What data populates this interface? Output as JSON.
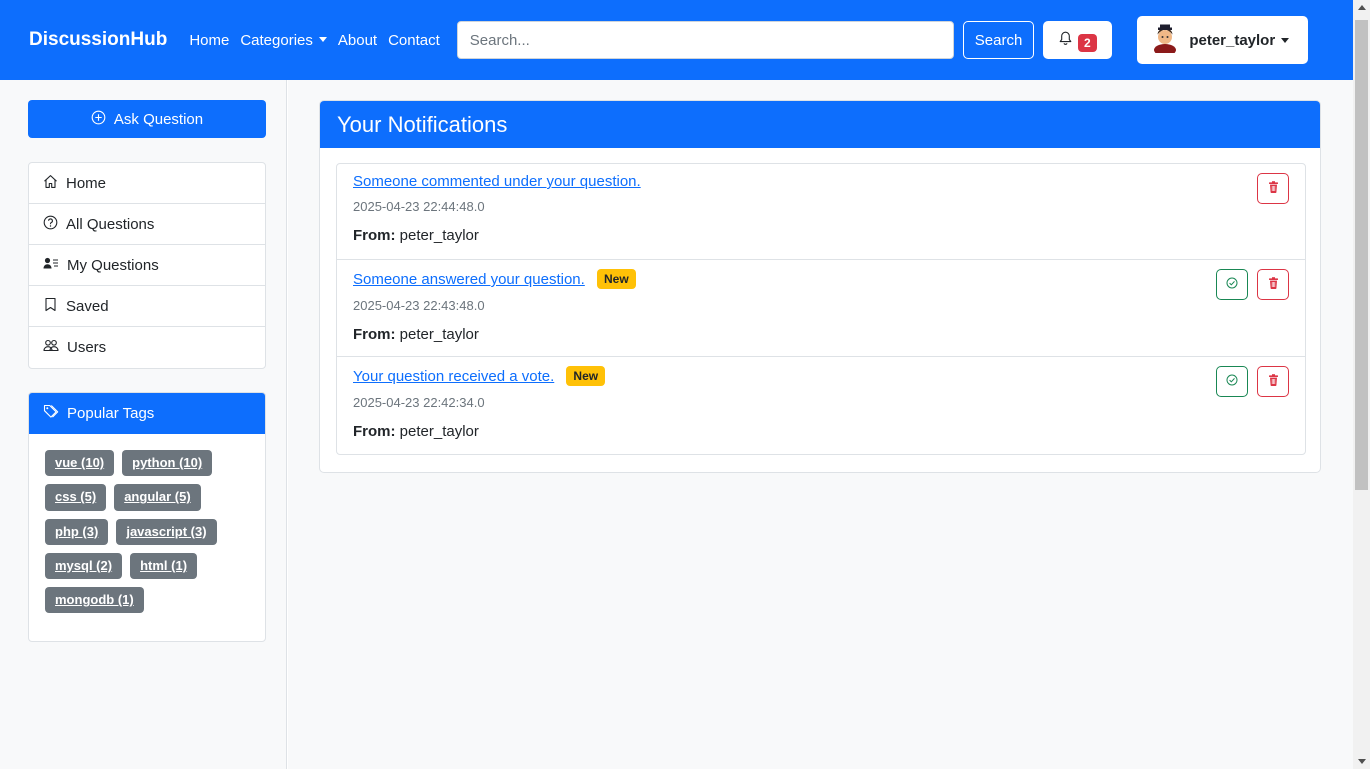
{
  "navbar": {
    "brand": "DiscussionHub",
    "links": {
      "home": "Home",
      "categories": "Categories",
      "about": "About",
      "contact": "Contact"
    },
    "search_placeholder": "Search...",
    "search_label": "Search",
    "notification_count": "2",
    "username": "peter_taylor"
  },
  "sidebar": {
    "ask_label": "Ask Question",
    "nav": {
      "home": "Home",
      "all_questions": "All Questions",
      "my_questions": "My Questions",
      "saved": "Saved",
      "users": "Users"
    },
    "tags_title": "Popular Tags",
    "tags": [
      "vue (10)",
      "python (10)",
      "css (5)",
      "angular (5)",
      "php (3)",
      "javascript (3)",
      "mysql (2)",
      "html (1)",
      "mongodb (1)"
    ]
  },
  "main": {
    "title": "Your Notifications",
    "from_label": "From:",
    "new_label": "New",
    "notifications": [
      {
        "text": "Someone commented under your question.",
        "time": "2025-04-23 22:44:48.0",
        "from": "peter_taylor",
        "is_new": false
      },
      {
        "text": "Someone answered your question.",
        "time": "2025-04-23 22:43:48.0",
        "from": "peter_taylor",
        "is_new": true
      },
      {
        "text": "Your question received a vote.",
        "time": "2025-04-23 22:42:34.0",
        "from": "peter_taylor",
        "is_new": true
      }
    ]
  },
  "colors": {
    "primary": "#0d6efd",
    "danger": "#dc3545",
    "success": "#198754",
    "warning": "#ffc107",
    "secondary": "#6c757d"
  }
}
